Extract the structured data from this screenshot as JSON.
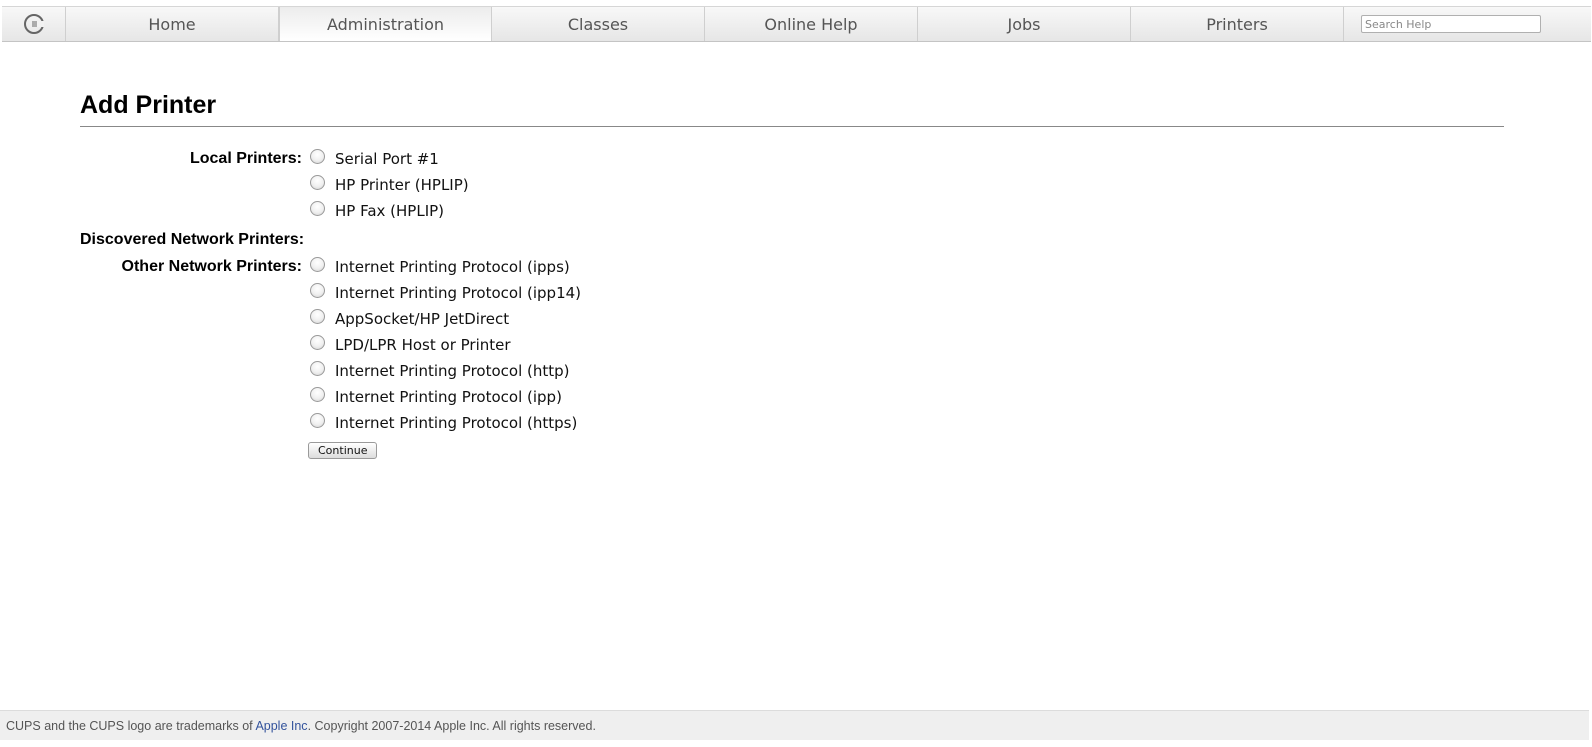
{
  "nav": {
    "logo_icon": "cups-logo-icon",
    "tabs": [
      {
        "label": "Home",
        "active": false
      },
      {
        "label": "Administration",
        "active": true
      },
      {
        "label": "Classes",
        "active": false
      },
      {
        "label": "Online Help",
        "active": false
      },
      {
        "label": "Jobs",
        "active": false
      },
      {
        "label": "Printers",
        "active": false
      }
    ],
    "search_placeholder": "Search Help"
  },
  "page": {
    "title": "Add Printer"
  },
  "form": {
    "local_label": "Local Printers:",
    "local_options": [
      "Serial Port #1",
      "HP Printer (HPLIP)",
      "HP Fax (HPLIP)"
    ],
    "discovered_label": "Discovered Network Printers:",
    "other_label": "Other Network Printers:",
    "other_options": [
      "Internet Printing Protocol (ipps)",
      "Internet Printing Protocol (ipp14)",
      "AppSocket/HP JetDirect",
      "LPD/LPR Host or Printer",
      "Internet Printing Protocol (http)",
      "Internet Printing Protocol (ipp)",
      "Internet Printing Protocol (https)"
    ],
    "continue_label": "Continue"
  },
  "footer": {
    "text_before": "CUPS and the CUPS logo are trademarks of ",
    "link_text": "Apple Inc",
    "text_after": ". Copyright 2007-2014 Apple Inc. All rights reserved."
  }
}
